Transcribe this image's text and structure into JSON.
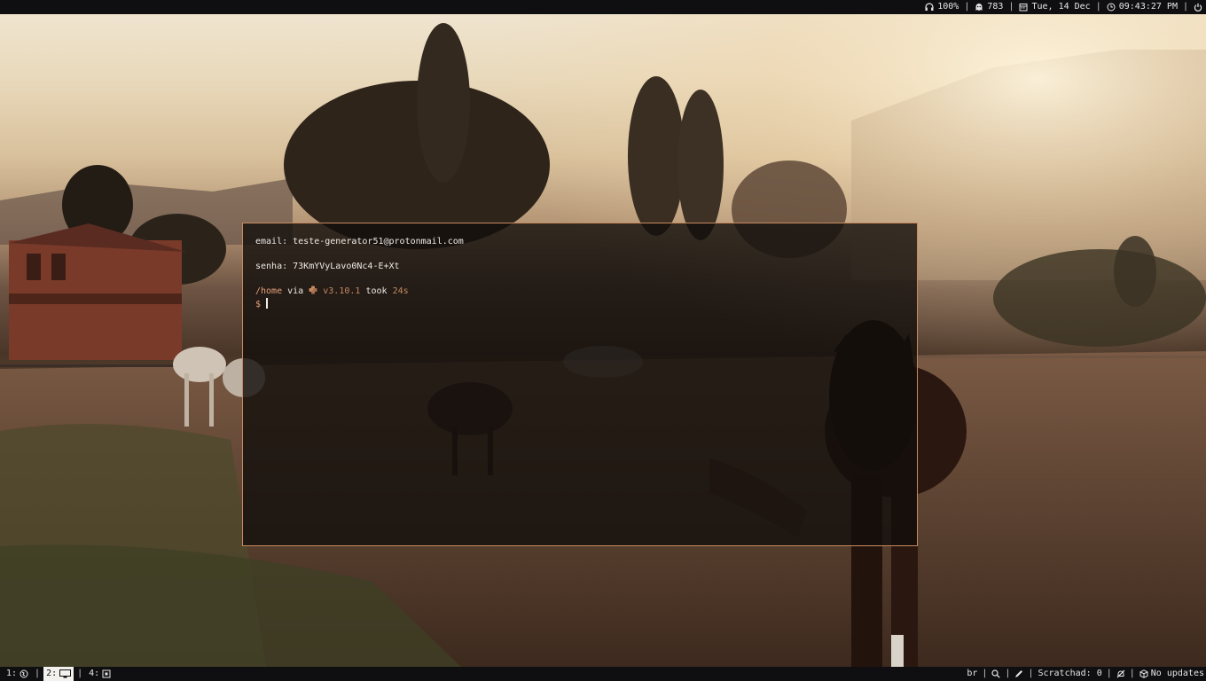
{
  "topbar": {
    "volume": "100%",
    "ghost_count": "783",
    "date": "Tue, 14 Dec",
    "time": "09:43:27 PM"
  },
  "terminal": {
    "line1": "email: teste-generator51@protonmail.com",
    "line2": "senha: 73KmYVyLavo0Nc4-E+Xt",
    "prompt_path": "/home",
    "prompt_via": "via",
    "prompt_version": "v3.10.1",
    "prompt_took": "took",
    "prompt_duration": "24s",
    "prompt_symbol": "$"
  },
  "bottombar": {
    "workspaces": [
      {
        "label": "1:",
        "icon": "globe-icon"
      },
      {
        "label": "2:",
        "icon": "monitor-icon"
      },
      {
        "label": "4:",
        "icon": "window-icon"
      }
    ],
    "active_workspace": "2:",
    "keyboard_layout": "br",
    "scratchpad": "Scratchad: 0",
    "updates": "No updates"
  },
  "colors": {
    "accent": "#c88a5e",
    "bar_bg": "#0f0f12",
    "prompt_path": "#e6a17a"
  }
}
